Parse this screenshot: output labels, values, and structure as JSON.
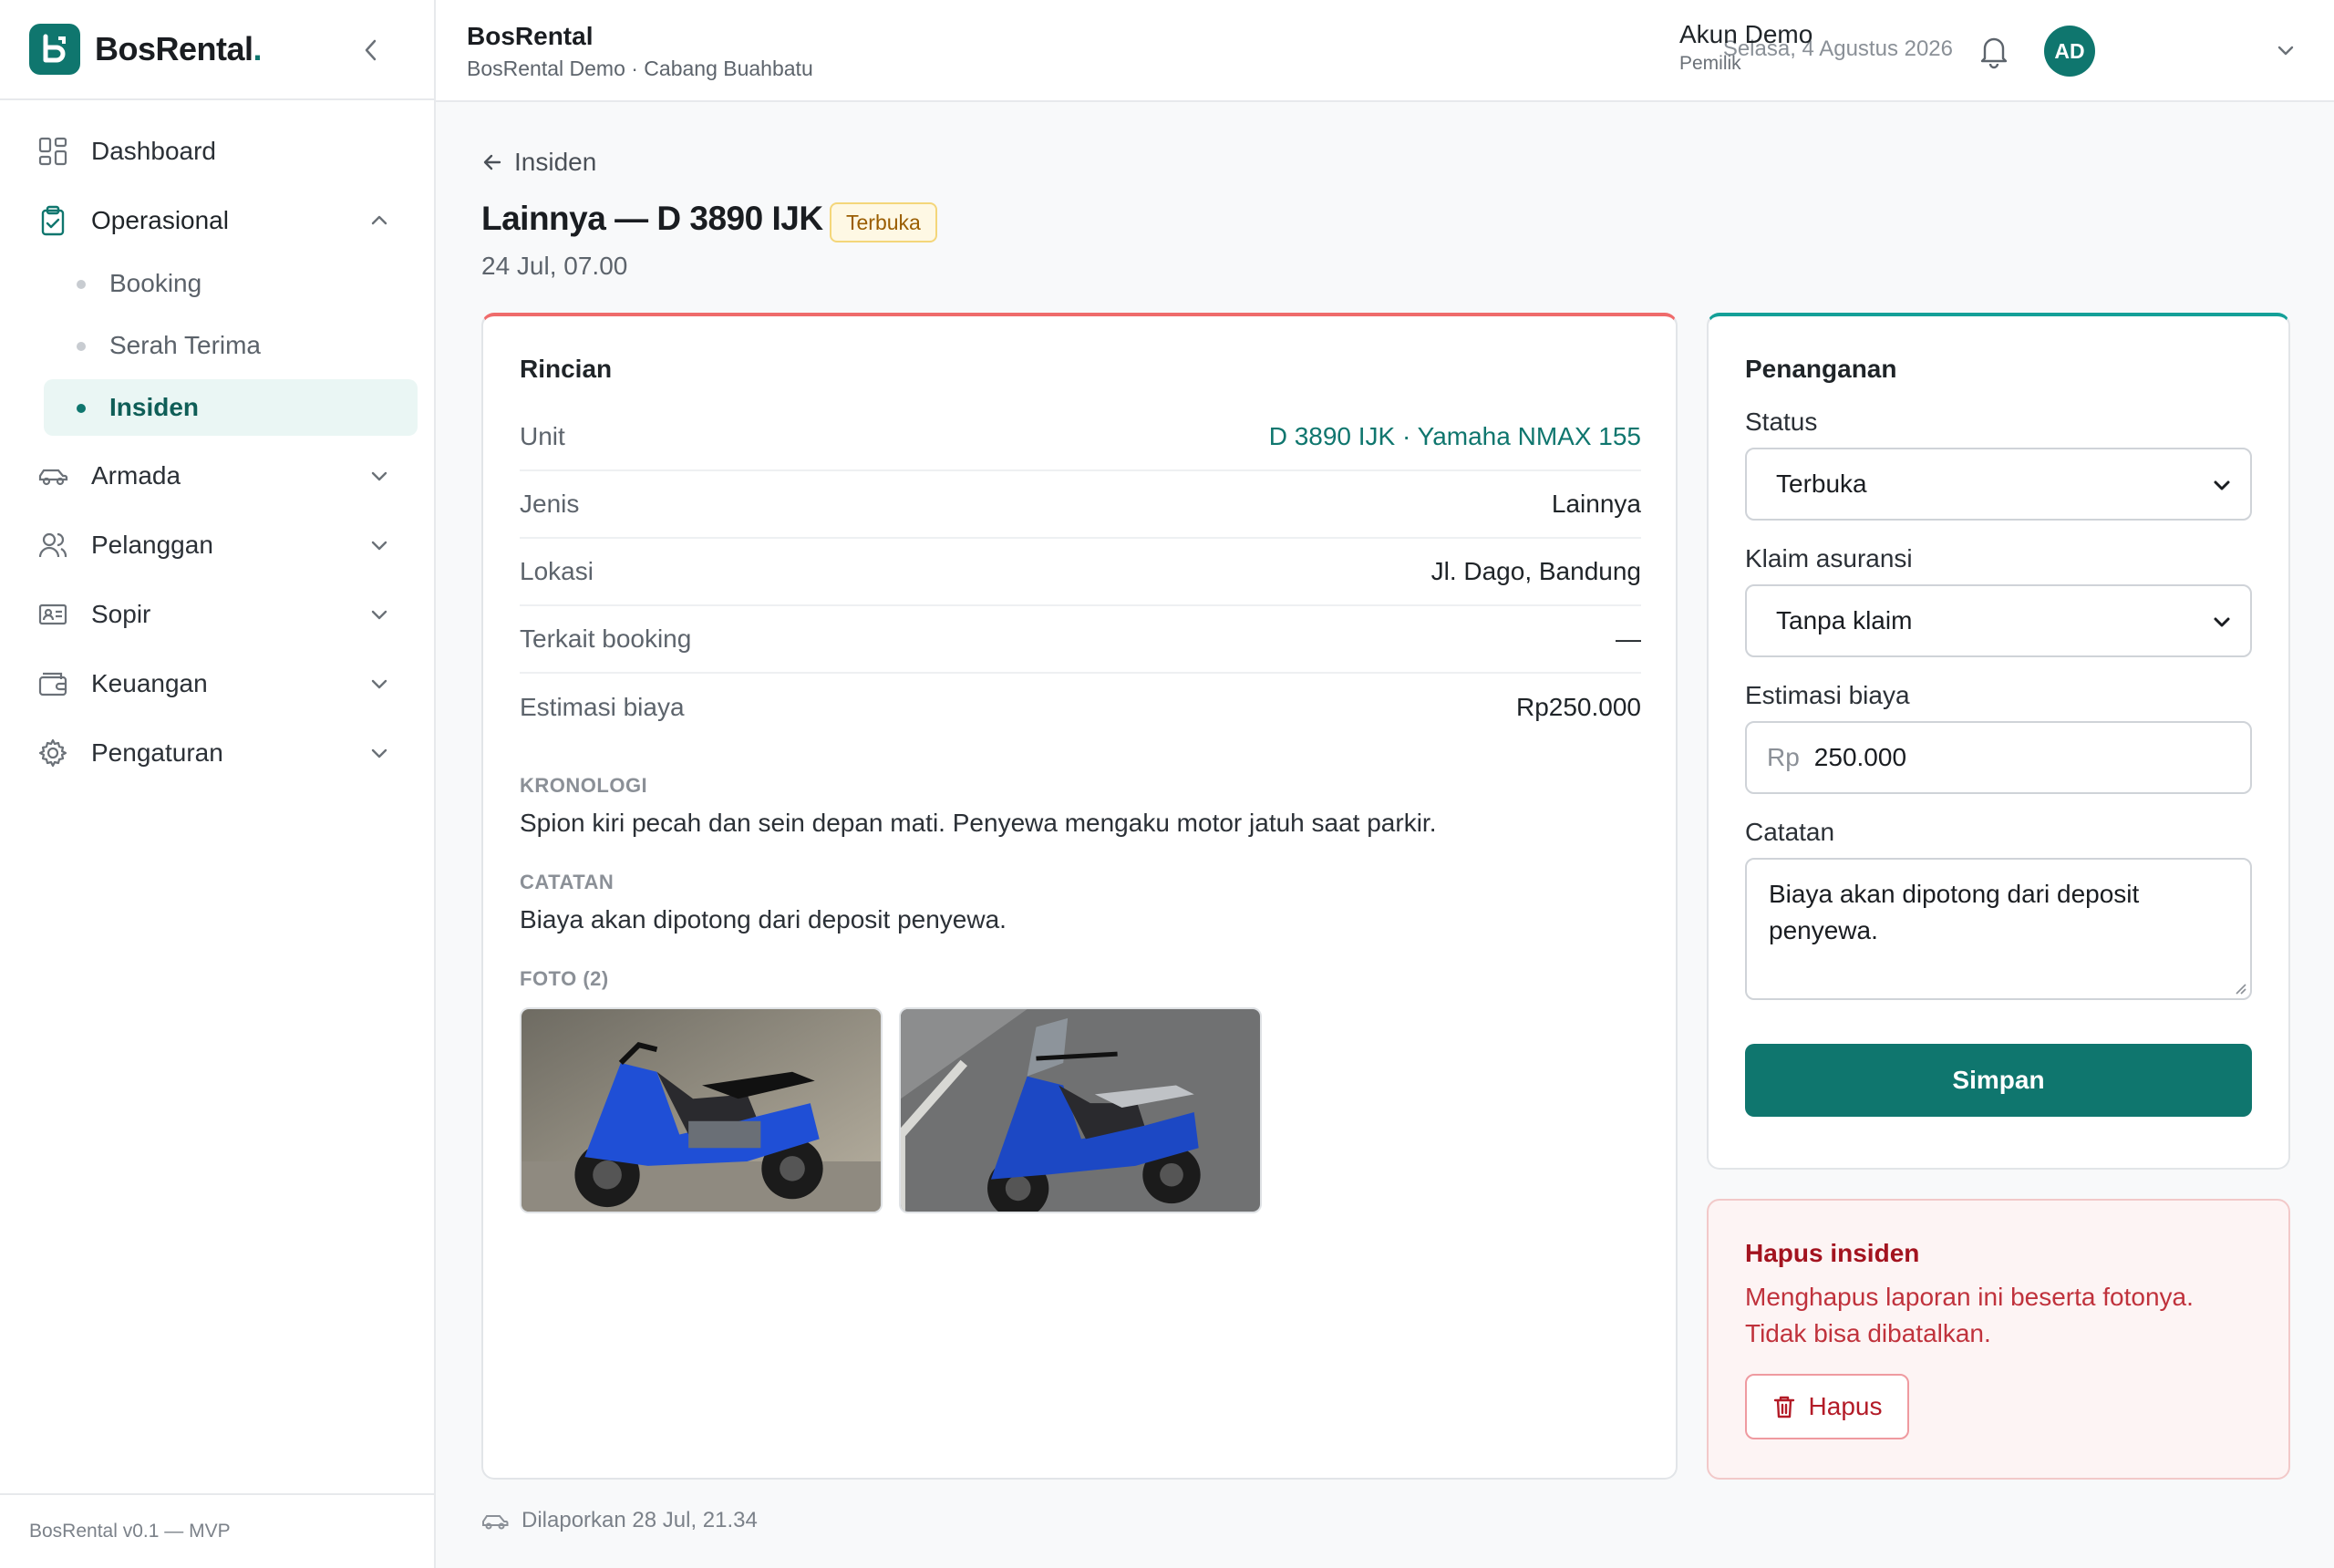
{
  "brand": {
    "name": "BosRental",
    "dot": "."
  },
  "sidebar": {
    "items": [
      {
        "label": "Dashboard",
        "icon": "grid-icon"
      },
      {
        "label": "Operasional",
        "icon": "clipboard-check-icon",
        "expanded": true,
        "children": [
          {
            "label": "Booking"
          },
          {
            "label": "Serah Terima"
          },
          {
            "label": "Insiden",
            "active": true
          }
        ]
      },
      {
        "label": "Armada",
        "icon": "car-icon"
      },
      {
        "label": "Pelanggan",
        "icon": "users-icon"
      },
      {
        "label": "Sopir",
        "icon": "id-card-icon"
      },
      {
        "label": "Keuangan",
        "icon": "wallet-icon"
      },
      {
        "label": "Pengaturan",
        "icon": "gear-icon"
      }
    ],
    "footer": "BosRental v0.1 — MVP"
  },
  "header": {
    "title": "BosRental",
    "subtitle": "BosRental Demo · Cabang Buahbatu",
    "date": "Selasa, 4 Agustus 2026",
    "user": {
      "initials": "AD",
      "name": "Akun Demo",
      "role": "Pemilik"
    }
  },
  "page": {
    "back_label": "Insiden",
    "title": "Lainnya — D 3890 IJK",
    "status_badge": "Terbuka",
    "date": "24 Jul, 07.00",
    "reported": "Dilaporkan 28 Jul, 21.34"
  },
  "detail": {
    "heading": "Rincian",
    "rows": [
      {
        "key": "Unit",
        "value": "D 3890 IJK · Yamaha NMAX 155",
        "link": true
      },
      {
        "key": "Jenis",
        "value": "Lainnya"
      },
      {
        "key": "Lokasi",
        "value": "Jl. Dago, Bandung"
      },
      {
        "key": "Terkait booking",
        "value": "—"
      },
      {
        "key": "Estimasi biaya",
        "value": "Rp250.000"
      }
    ],
    "chronology_label": "KRONOLOGI",
    "chronology": "Spion kiri pecah dan sein depan mati. Penyewa mengaku motor jatuh saat parkir.",
    "notes_label": "CATATAN",
    "notes": "Biaya akan dipotong dari deposit penyewa.",
    "photos_label": "FOTO (2)"
  },
  "handling": {
    "heading": "Penanganan",
    "status_label": "Status",
    "status_value": "Terbuka",
    "claim_label": "Klaim asuransi",
    "claim_value": "Tanpa klaim",
    "cost_label": "Estimasi biaya",
    "cost_prefix": "Rp",
    "cost_value": "250.000",
    "notes_label": "Catatan",
    "notes_value": "Biaya akan dipotong dari deposit penyewa.",
    "save_label": "Simpan"
  },
  "danger": {
    "title": "Hapus insiden",
    "text": "Menghapus laporan ini beserta fotonya. Tidak bisa dibatalkan.",
    "delete_label": "Hapus"
  },
  "colors": {
    "accent": "#0f766e",
    "danger": "#b31b27",
    "badge_bg": "#fef8e4"
  }
}
